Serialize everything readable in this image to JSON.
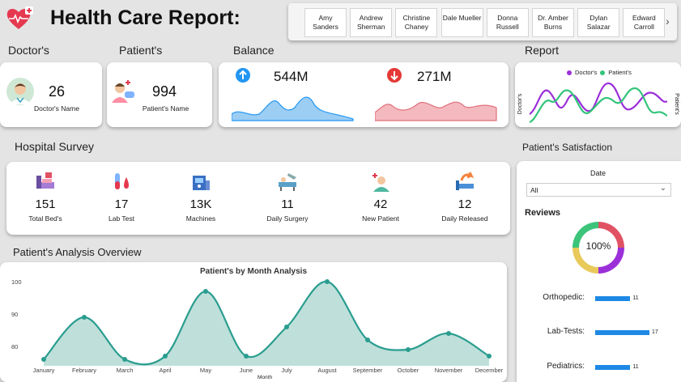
{
  "header": {
    "title": "Health Care Report:"
  },
  "slicer": {
    "names": [
      "Amy Sanders",
      "Andrew Sherman",
      "Christine Chaney",
      "Dale Mueller",
      "Donna Russell",
      "Dr. Amber Burns",
      "Dylan Salazar",
      "Edward Carroll"
    ]
  },
  "sections": {
    "doctors": "Doctor's",
    "patients": "Patient's",
    "balance": "Balance",
    "report": "Report",
    "survey": "Hospital Survey",
    "satisfaction": "Patient's Satisfaction",
    "analysis": "Patient's Analysis Overview"
  },
  "doctors_card": {
    "value": "26",
    "label": "Doctor's Name"
  },
  "patients_card": {
    "value": "994",
    "label": "Patient's Name"
  },
  "balance": {
    "up_value": "544M",
    "down_value": "271M",
    "up_color": "#2196f3",
    "down_color": "#e53935"
  },
  "report": {
    "legend_doctor": "Doctor's",
    "legend_patient": "Patient's",
    "y_left": "Doctor's",
    "y_right": "Patient's",
    "doctor_color": "#9b30d9",
    "patient_color": "#33c47a"
  },
  "survey": [
    {
      "value": "151",
      "label": "Total Bed's",
      "icon": "hospital-bed-icon"
    },
    {
      "value": "17",
      "label": "Lab Test",
      "icon": "test-tube-icon"
    },
    {
      "value": "13K",
      "label": "Machines",
      "icon": "medical-machine-icon"
    },
    {
      "value": "11",
      "label": "Daily Surgery",
      "icon": "surgery-icon"
    },
    {
      "value": "42",
      "label": "New Patient",
      "icon": "new-patient-icon"
    },
    {
      "value": "12",
      "label": "Daily Released",
      "icon": "released-bed-icon"
    }
  ],
  "satisfaction": {
    "date_label": "Date",
    "date_value": "All",
    "reviews_title": "Reviews",
    "donut_value": "100%",
    "bars": [
      {
        "label": "Orthopedic:",
        "value": 11
      },
      {
        "label": "Lab-Tests:",
        "value": 17
      },
      {
        "label": "Pediatrics:",
        "value": 11
      }
    ],
    "bar_color": "#1e88e5"
  },
  "chart_data": {
    "type": "area",
    "title": "Patient's by Month Analysis",
    "xlabel": "Month",
    "ylabel": "",
    "categories": [
      "January",
      "February",
      "March",
      "April",
      "May",
      "June",
      "July",
      "August",
      "September",
      "October",
      "November",
      "December"
    ],
    "values": [
      76,
      89,
      76,
      77,
      97,
      77,
      86,
      100,
      82,
      79,
      84,
      77
    ],
    "yticks": [
      80,
      90,
      100
    ],
    "ylim": [
      74,
      101
    ],
    "color": "#2a9d8f"
  }
}
